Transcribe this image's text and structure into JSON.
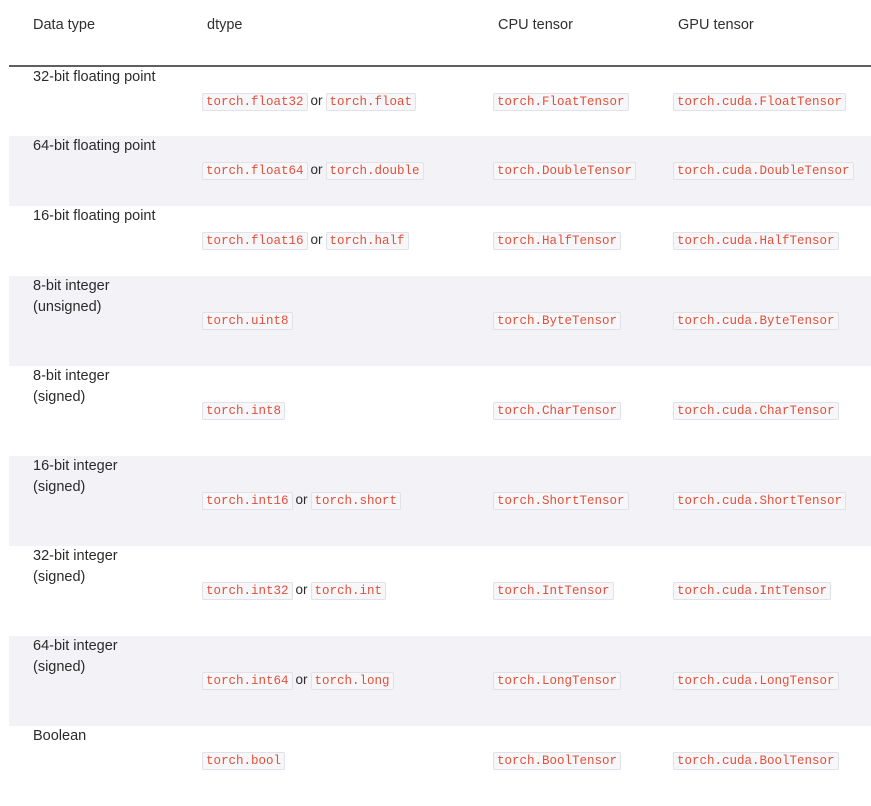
{
  "table": {
    "columns": [
      {
        "key": "datatype",
        "label": "Data type"
      },
      {
        "key": "dtype",
        "label": "dtype"
      },
      {
        "key": "cpu",
        "label": "CPU tensor"
      },
      {
        "key": "gpu",
        "label": "GPU tensor"
      }
    ],
    "separator_word": "or",
    "rows": [
      {
        "datatype_line1": "32-bit floating point",
        "datatype_line2": "",
        "dtype_primary": "torch.float32",
        "dtype_alias": "torch.float",
        "cpu": "torch.FloatTensor",
        "gpu": "torch.cuda.FloatTensor",
        "striped": false,
        "tall": false
      },
      {
        "datatype_line1": "64-bit floating point",
        "datatype_line2": "",
        "dtype_primary": "torch.float64",
        "dtype_alias": "torch.double",
        "cpu": "torch.DoubleTensor",
        "gpu": "torch.cuda.DoubleTensor",
        "striped": true,
        "tall": false
      },
      {
        "datatype_line1": "16-bit floating point",
        "datatype_line2": "",
        "dtype_primary": "torch.float16",
        "dtype_alias": "torch.half",
        "cpu": "torch.HalfTensor",
        "gpu": "torch.cuda.HalfTensor",
        "striped": false,
        "tall": false
      },
      {
        "datatype_line1": "8-bit integer",
        "datatype_line2": "(unsigned)",
        "dtype_primary": "torch.uint8",
        "dtype_alias": "",
        "cpu": "torch.ByteTensor",
        "gpu": "torch.cuda.ByteTensor",
        "striped": true,
        "tall": true
      },
      {
        "datatype_line1": "8-bit integer",
        "datatype_line2": "(signed)",
        "dtype_primary": "torch.int8",
        "dtype_alias": "",
        "cpu": "torch.CharTensor",
        "gpu": "torch.cuda.CharTensor",
        "striped": false,
        "tall": true
      },
      {
        "datatype_line1": "16-bit integer",
        "datatype_line2": "(signed)",
        "dtype_primary": "torch.int16",
        "dtype_alias": "torch.short",
        "cpu": "torch.ShortTensor",
        "gpu": "torch.cuda.ShortTensor",
        "striped": true,
        "tall": true
      },
      {
        "datatype_line1": "32-bit integer",
        "datatype_line2": "(signed)",
        "dtype_primary": "torch.int32",
        "dtype_alias": "torch.int",
        "cpu": "torch.IntTensor",
        "gpu": "torch.cuda.IntTensor",
        "striped": false,
        "tall": true
      },
      {
        "datatype_line1": "64-bit integer",
        "datatype_line2": "(signed)",
        "dtype_primary": "torch.int64",
        "dtype_alias": "torch.long",
        "cpu": "torch.LongTensor",
        "gpu": "torch.cuda.LongTensor",
        "striped": true,
        "tall": true
      },
      {
        "datatype_line1": "Boolean",
        "datatype_line2": "",
        "dtype_primary": "torch.bool",
        "dtype_alias": "",
        "cpu": "torch.BoolTensor",
        "gpu": "torch.cuda.BoolTensor",
        "striped": false,
        "tall": false
      }
    ]
  },
  "colors": {
    "code_text": "#e0503a",
    "code_background": "#f7f7f9",
    "code_border": "#e1e1e8",
    "row_stripe": "#f2f2f7",
    "header_rule": "#5f5f5f",
    "body_text": "#2b2b2b"
  }
}
